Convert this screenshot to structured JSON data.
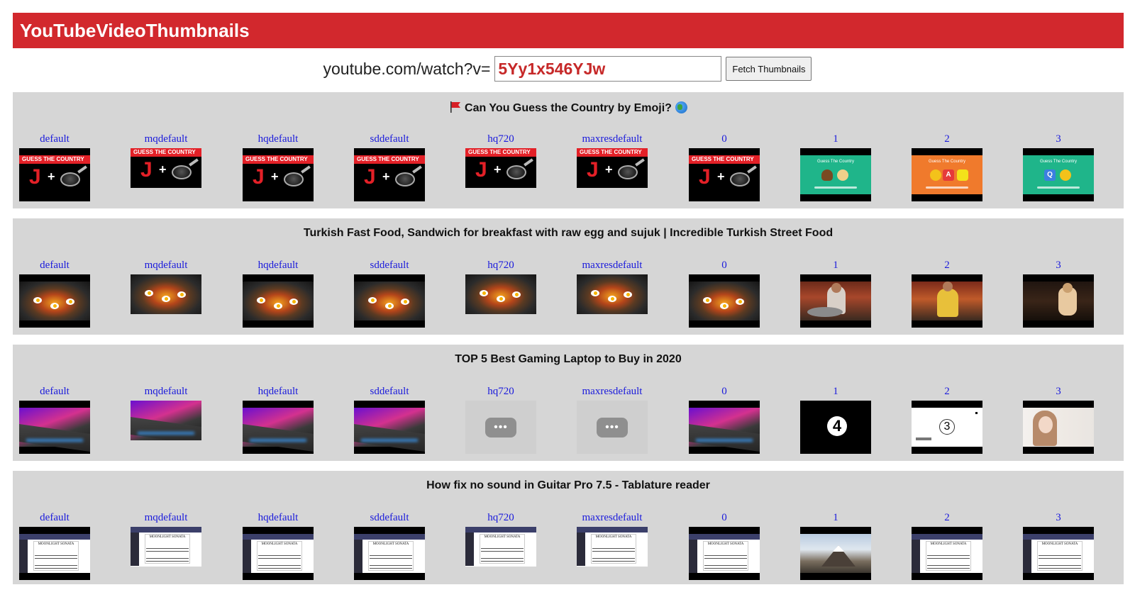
{
  "header": {
    "title": "YouTubeVideoThumbnails"
  },
  "fetch": {
    "prefix": "youtube.com/watch?v=",
    "video_id": "5Yy1x546YJw",
    "button_label": "Fetch Thumbnails"
  },
  "labels": [
    "default",
    "mqdefault",
    "hqdefault",
    "sddefault",
    "hq720",
    "maxresdefault",
    "0",
    "1",
    "2",
    "3"
  ],
  "sections": [
    {
      "title": "Can You Guess the Country by Emoji?",
      "thumb_texts": {
        "band": "GUESS THE COUNTRY",
        "letter": "J",
        "plus": "+",
        "gq_title": "Guess The Country",
        "box_a": "A",
        "box_q": "Q"
      }
    },
    {
      "title": "Turkish Fast Food, Sandwich for breakfast with raw egg and sujuk | Incredible Turkish Street Food"
    },
    {
      "title": "TOP 5 Best Gaming Laptop to Buy in 2020",
      "thumb_texts": {
        "count_4": "4",
        "count_3": "3"
      }
    },
    {
      "title": "How fix no sound in Guitar Pro 7.5 - Tablature reader",
      "thumb_texts": {
        "sheet_title": "MOONLIGHT SONATA"
      }
    }
  ],
  "icons": {
    "flag": "red-flag-icon",
    "globe": "globe-icon"
  },
  "colors": {
    "header_bg": "#d2282d",
    "link": "#1a1adc",
    "input_text": "#c62828",
    "section_bg": "#d6d6d6"
  }
}
